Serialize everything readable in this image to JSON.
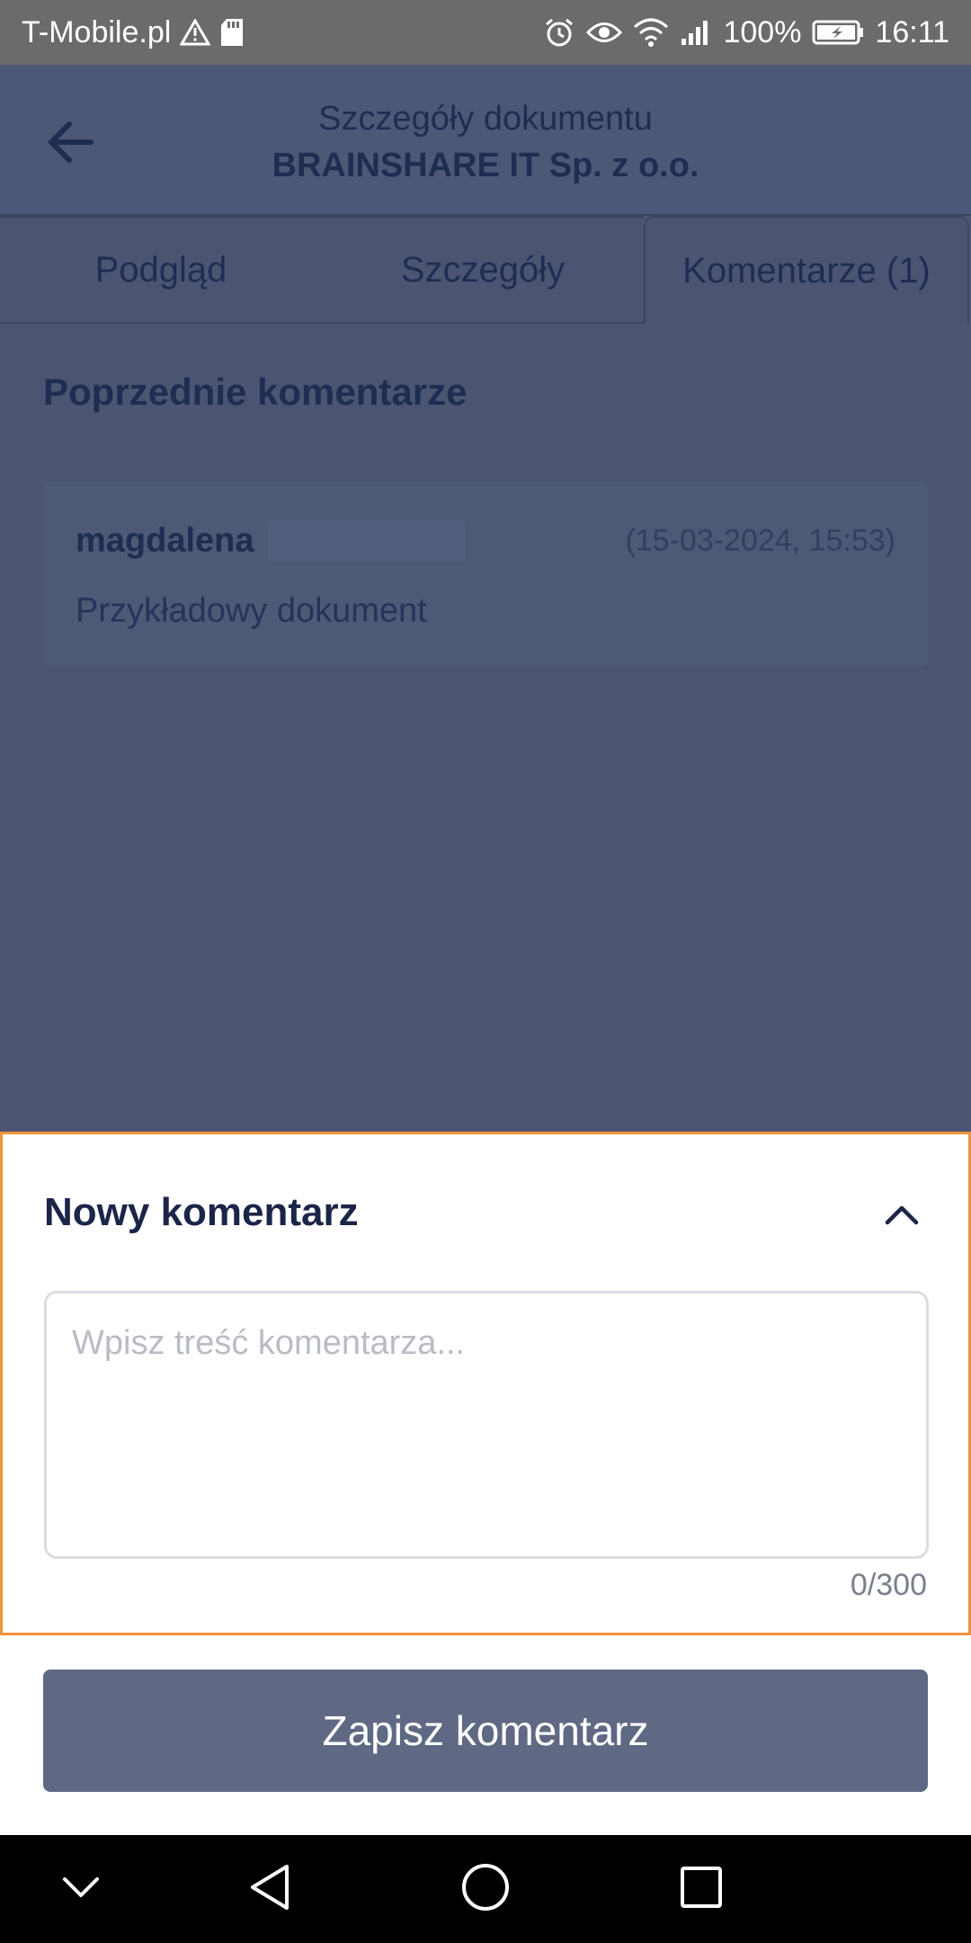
{
  "status_bar": {
    "carrier": "T-Mobile.pl",
    "battery": "100%",
    "time": "16:11",
    "icons": [
      "warning-icon",
      "sd-card-icon",
      "alarm-icon",
      "eye-icon",
      "wifi-icon",
      "signal-icon",
      "battery-icon"
    ]
  },
  "header": {
    "title": "Szczegóły dokumentu",
    "subtitle": "BRAINSHARE IT Sp. z o.o.",
    "back_icon": "arrow-left-icon"
  },
  "tabs": [
    {
      "label": "Podgląd",
      "active": false
    },
    {
      "label": "Szczegóły",
      "active": false
    },
    {
      "label": "Komentarze (1)",
      "active": true
    }
  ],
  "comments": {
    "section_title": "Poprzednie komentarze",
    "items": [
      {
        "author": "magdalena",
        "date": "(15-03-2024, 15:53)",
        "text": "Przykładowy dokument"
      }
    ]
  },
  "new_comment": {
    "title": "Nowy komentarz",
    "collapse_icon": "chevron-up-icon",
    "value": "",
    "placeholder": "Wpisz treść komentarza...",
    "counter": "0/300"
  },
  "save_button": {
    "label": "Zapisz komentarz"
  },
  "colors": {
    "overlay": "#4b5572",
    "primary_text": "#1b2548",
    "sheet_border": "#f0923a",
    "button": "#5f6984"
  },
  "nav_bar": {
    "icons": [
      "chevron-down-icon",
      "back-triangle-icon",
      "home-circle-icon",
      "recents-square-icon"
    ]
  }
}
